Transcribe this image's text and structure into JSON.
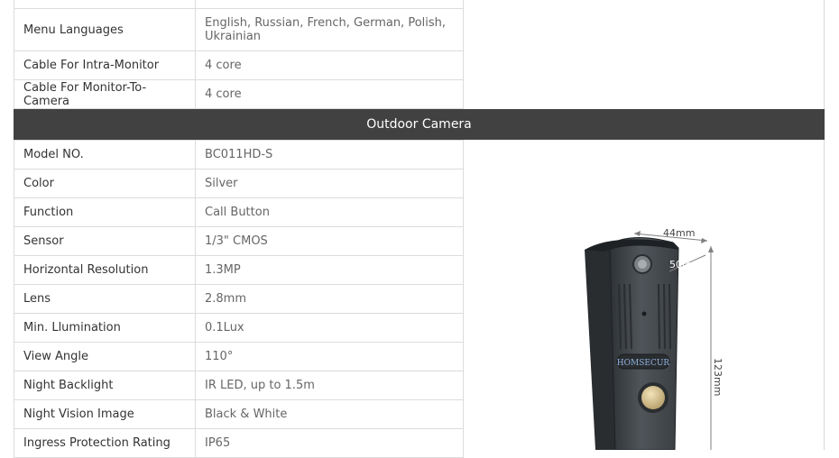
{
  "top_table": {
    "rows": [
      {
        "label": "",
        "value": ""
      },
      {
        "label": "Menu Languages",
        "value": "English, Russian, French, German, Polish, Ukrainian"
      },
      {
        "label": "Cable For Intra-Monitor",
        "value": "4 core"
      },
      {
        "label": "Cable For Monitor-To-Camera",
        "value": "4 core"
      }
    ]
  },
  "section": {
    "title": "Outdoor Camera"
  },
  "camera_table": {
    "rows": [
      {
        "label": "Model NO.",
        "value": "BC011HD-S"
      },
      {
        "label": "Color",
        "value": "Silver"
      },
      {
        "label": "Function",
        "value": "Call Button"
      },
      {
        "label": "Sensor",
        "value": "1/3\" CMOS"
      },
      {
        "label": "Horizontal Resolution",
        "value": "1.3MP"
      },
      {
        "label": "Lens",
        "value": "2.8mm"
      },
      {
        "label": "Min. Llumination",
        "value": "0.1Lux"
      },
      {
        "label": "View Angle",
        "value": "110°"
      },
      {
        "label": "Night Backlight",
        "value": "IR LED, up to 1.5m"
      },
      {
        "label": "Night Vision Image",
        "value": "Black & White"
      },
      {
        "label": "Ingress Protection Rating",
        "value": "IP65"
      }
    ]
  },
  "product_image": {
    "brand": "HOMSECUR",
    "dim_width": "44mm",
    "dim_depth": "50mm",
    "dim_height": "123mm",
    "body_color": "#4a4e52",
    "brand_color": "#8fb3e0"
  }
}
